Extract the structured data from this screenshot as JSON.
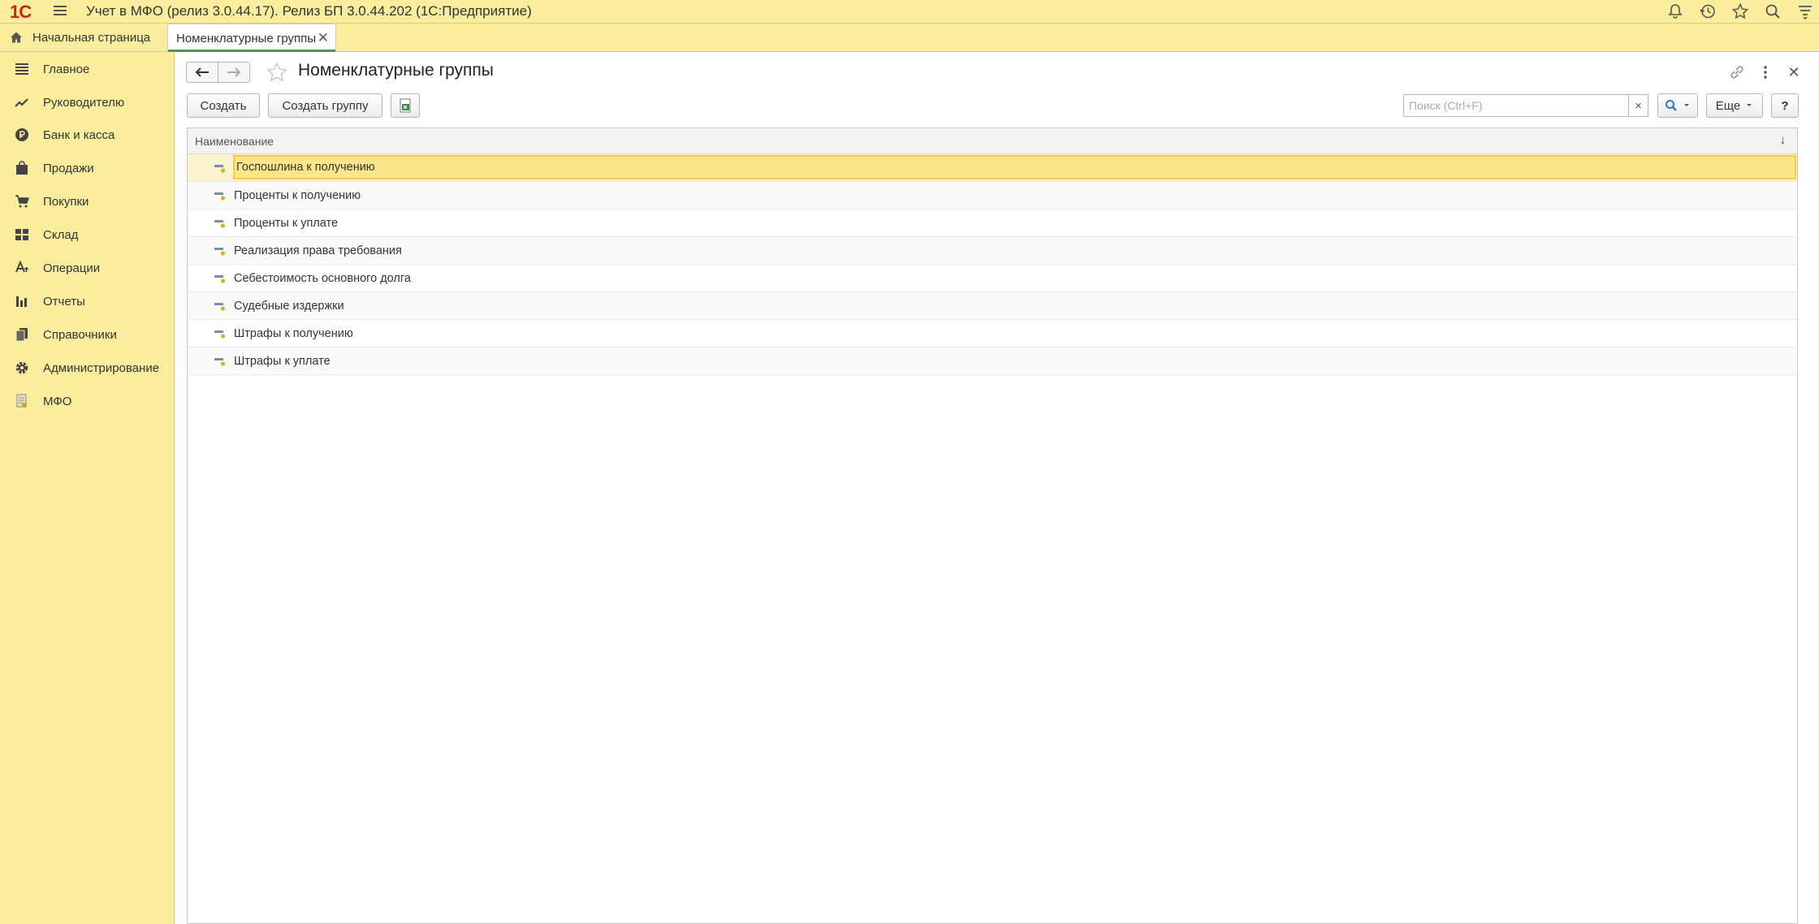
{
  "app": {
    "logo_text": "1С",
    "title": "Учет в МФО (релиз 3.0.44.17). Релиз БП 3.0.44.202  (1С:Предприятие)"
  },
  "titlebar_icons": [
    "bell-icon",
    "history-icon",
    "star-icon",
    "search-icon",
    "settings-menu-icon"
  ],
  "tabs": {
    "home": "Начальная страница",
    "active": "Номенклатурные группы"
  },
  "sidebar": {
    "items": [
      {
        "label": "Главное",
        "icon": "menu-lines-icon"
      },
      {
        "label": "Руководителю",
        "icon": "trend-icon"
      },
      {
        "label": "Банк и касса",
        "icon": "ruble-coin-icon"
      },
      {
        "label": "Продажи",
        "icon": "shopping-bag-icon"
      },
      {
        "label": "Покупки",
        "icon": "cart-icon"
      },
      {
        "label": "Склад",
        "icon": "warehouse-grid-icon"
      },
      {
        "label": "Операции",
        "icon": "operations-icon"
      },
      {
        "label": "Отчеты",
        "icon": "bar-chart-icon"
      },
      {
        "label": "Справочники",
        "icon": "books-icon"
      },
      {
        "label": "Администрирование",
        "icon": "gear-icon"
      },
      {
        "label": "МФО",
        "icon": "mfo-document-icon"
      }
    ]
  },
  "form": {
    "title": "Номенклатурные группы",
    "buttons": {
      "create": "Создать",
      "create_group": "Создать группу",
      "more": "Еще",
      "help": "?"
    },
    "search_placeholder": "Поиск (Ctrl+F)",
    "clear": "×"
  },
  "table": {
    "column_name": "Наименование",
    "sort_indicator": "↓",
    "rows": [
      "Госпошлина к получению",
      "Проценты к получению",
      "Проценты к уплате",
      "Реализация права требования",
      "Себестоимость основного долга",
      "Судебные издержки",
      "Штрафы к получению",
      "Штрафы к уплате"
    ],
    "selected_row": "Госпошлина к получению"
  },
  "colors": {
    "panel_yellow": "#fbed9e",
    "selection_yellow": "#fce68a",
    "logo_red": "#d0211a",
    "active_tab_underline": "#4a9a4a"
  }
}
